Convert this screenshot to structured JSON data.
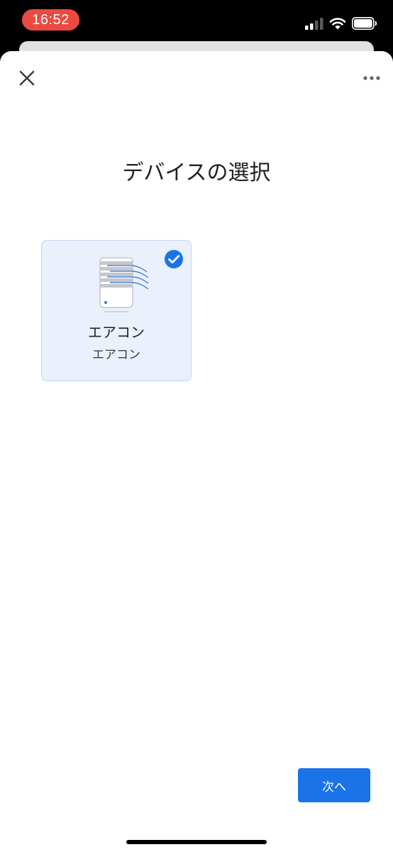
{
  "status_bar": {
    "time": "16:52",
    "icons": [
      "cellular-signal-icon",
      "wifi-icon",
      "battery-icon"
    ]
  },
  "header": {
    "close_icon": "close-icon",
    "more_icon": "more-horizontal-icon"
  },
  "main": {
    "title": "デバイスの選択",
    "devices": [
      {
        "name": "エアコン",
        "type": "エアコン",
        "icon": "air-conditioner-icon",
        "selected": true
      }
    ]
  },
  "footer": {
    "next_label": "次へ"
  },
  "colors": {
    "accent": "#1a73e8",
    "card_selected_bg": "#eaf0fc",
    "time_pill": "#eb4a40"
  }
}
